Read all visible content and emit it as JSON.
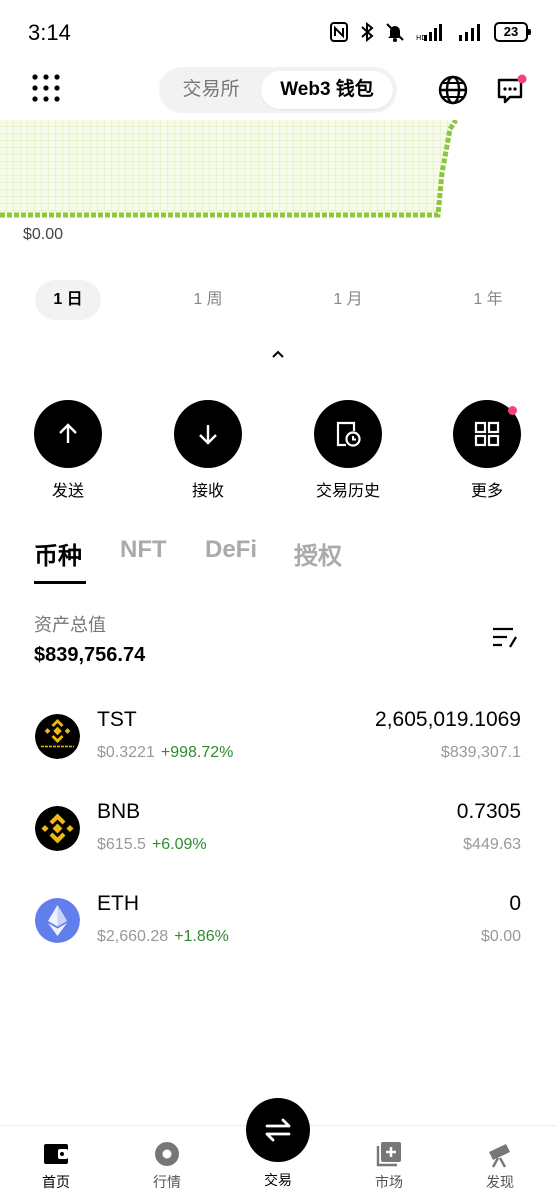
{
  "status_bar": {
    "time": "3:14",
    "battery": "23"
  },
  "header": {
    "tabs": [
      {
        "label": "交易所",
        "active": false
      },
      {
        "label": "Web3 钱包",
        "active": true
      }
    ]
  },
  "chart": {
    "axis_label": "$0.00",
    "accent_color": "#8cc63f"
  },
  "range_tabs": [
    "1 日",
    "1 周",
    "1 月",
    "1 年"
  ],
  "actions": [
    {
      "label": "发送",
      "icon": "arrow-up-icon"
    },
    {
      "label": "接收",
      "icon": "arrow-down-icon"
    },
    {
      "label": "交易历史",
      "icon": "history-icon"
    },
    {
      "label": "更多",
      "icon": "grid-icon"
    }
  ],
  "asset_tabs": [
    "币种",
    "NFT",
    "DeFi",
    "授权"
  ],
  "total": {
    "label": "资产总值",
    "value": "$839,756.74"
  },
  "tokens": [
    {
      "symbol": "TST",
      "price": "$0.3221",
      "change": "+998.72%",
      "balance": "2,605,019.1069",
      "value": "$839,307.1",
      "logo_text": "TEST TOKEN"
    },
    {
      "symbol": "BNB",
      "price": "$615.5",
      "change": "+6.09%",
      "balance": "0.7305",
      "value": "$449.63"
    },
    {
      "symbol": "ETH",
      "price": "$2,660.28",
      "change": "+1.86%",
      "balance": "0",
      "value": "$0.00"
    }
  ],
  "bottom_nav": [
    {
      "label": "首页",
      "icon": "wallet-icon"
    },
    {
      "label": "行情",
      "icon": "market-icon"
    },
    {
      "label": "交易",
      "icon": "swap-icon"
    },
    {
      "label": "市场",
      "icon": "marketplace-icon"
    },
    {
      "label": "发现",
      "icon": "telescope-icon"
    }
  ]
}
